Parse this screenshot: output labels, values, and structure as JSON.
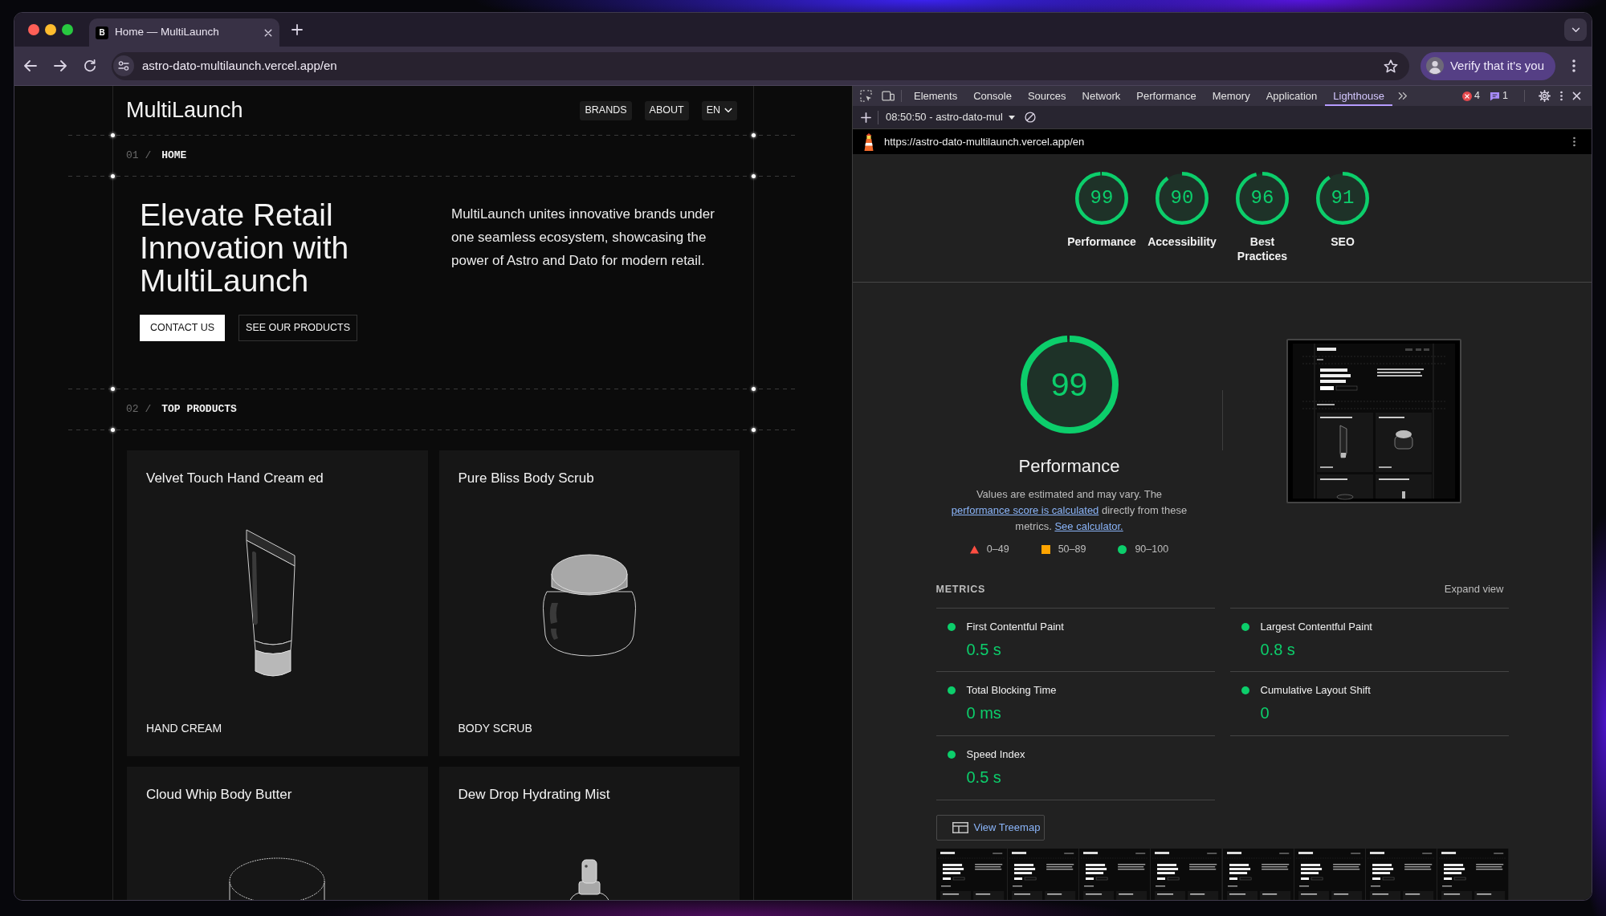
{
  "browser": {
    "tabs": [
      {
        "title": "Home — MultiLaunch",
        "favicon": "B",
        "selected": true
      }
    ],
    "address": "astro-dato-multilaunch.vercel.app/en",
    "profile_button": "Verify that it's you"
  },
  "page": {
    "logo": "MultiLaunch",
    "nav": [
      {
        "label": "BRANDS",
        "kind": "link"
      },
      {
        "label": "ABOUT",
        "kind": "link"
      },
      {
        "label": "EN",
        "kind": "dropdown"
      }
    ],
    "home_section": {
      "number": "01 /",
      "title": "HOME"
    },
    "hero": {
      "heading": "Elevate Retail Innovation with MultiLaunch",
      "text": "MultiLaunch unites innovative brands under one seamless ecosystem, showcasing the power of Astro and Dato for modern retail.",
      "buttons": [
        {
          "label": "CONTACT US",
          "kind": "primary"
        },
        {
          "label": "SEE OUR PRODUCTS",
          "kind": "outline"
        }
      ]
    },
    "products_section": {
      "number": "02 /",
      "title": "TOP PRODUCTS"
    },
    "products": [
      {
        "name": "Velvet Touch Hand Cream ed",
        "category": "HAND CREAM",
        "kind": "tube"
      },
      {
        "name": "Pure Bliss Body Scrub",
        "category": "BODY SCRUB",
        "kind": "jar"
      },
      {
        "name": "Cloud Whip Body Butter",
        "kind": "tub"
      },
      {
        "name": "Dew Drop Hydrating Mist",
        "kind": "spray"
      }
    ]
  },
  "devtools": {
    "tabs": [
      {
        "label": "Elements",
        "selected": false
      },
      {
        "label": "Console",
        "selected": false
      },
      {
        "label": "Sources",
        "selected": false
      },
      {
        "label": "Network",
        "selected": false
      },
      {
        "label": "Performance",
        "selected": false
      },
      {
        "label": "Memory",
        "selected": false
      },
      {
        "label": "Application",
        "selected": false
      },
      {
        "label": "Lighthouse",
        "selected": true
      }
    ],
    "error_count": "4",
    "message_count": "1",
    "report_select": "08:50:50 - astro-dato-mul",
    "url": "https://astro-dato-multilaunch.vercel.app/en",
    "scores": [
      {
        "label": "Performance",
        "score": "99"
      },
      {
        "label": "Accessibility",
        "score": "90"
      },
      {
        "label": "Best Practices",
        "score": "96"
      },
      {
        "label": "SEO",
        "score": "91"
      }
    ],
    "performance": {
      "score": "99",
      "title": "Performance",
      "description": [
        {
          "kind": "text",
          "text": "Values are estimated and may vary. The "
        },
        {
          "kind": "link",
          "text": "performance score is calculated"
        },
        {
          "kind": "text",
          "text": " directly from these metrics. "
        },
        {
          "kind": "link",
          "text": "See calculator."
        }
      ],
      "legend": [
        {
          "kind": "triangle",
          "color": "#ff4e42",
          "range": "0–49"
        },
        {
          "kind": "square",
          "color": "#ffa400",
          "range": "50–89"
        },
        {
          "kind": "circle",
          "color": "#0cce6b",
          "range": "90–100"
        }
      ]
    },
    "metrics": {
      "title": "METRICS",
      "toggle": "Expand view",
      "items": [
        {
          "name": "First Contentful Paint",
          "value": "0.5 s"
        },
        {
          "name": "Largest Contentful Paint",
          "value": "0.8 s"
        },
        {
          "name": "Total Blocking Time",
          "value": "0 ms"
        },
        {
          "name": "Cumulative Layout Shift",
          "value": "0"
        },
        {
          "name": "Speed Index",
          "value": "0.5 s"
        }
      ]
    },
    "treemap_button": "View Treemap"
  }
}
